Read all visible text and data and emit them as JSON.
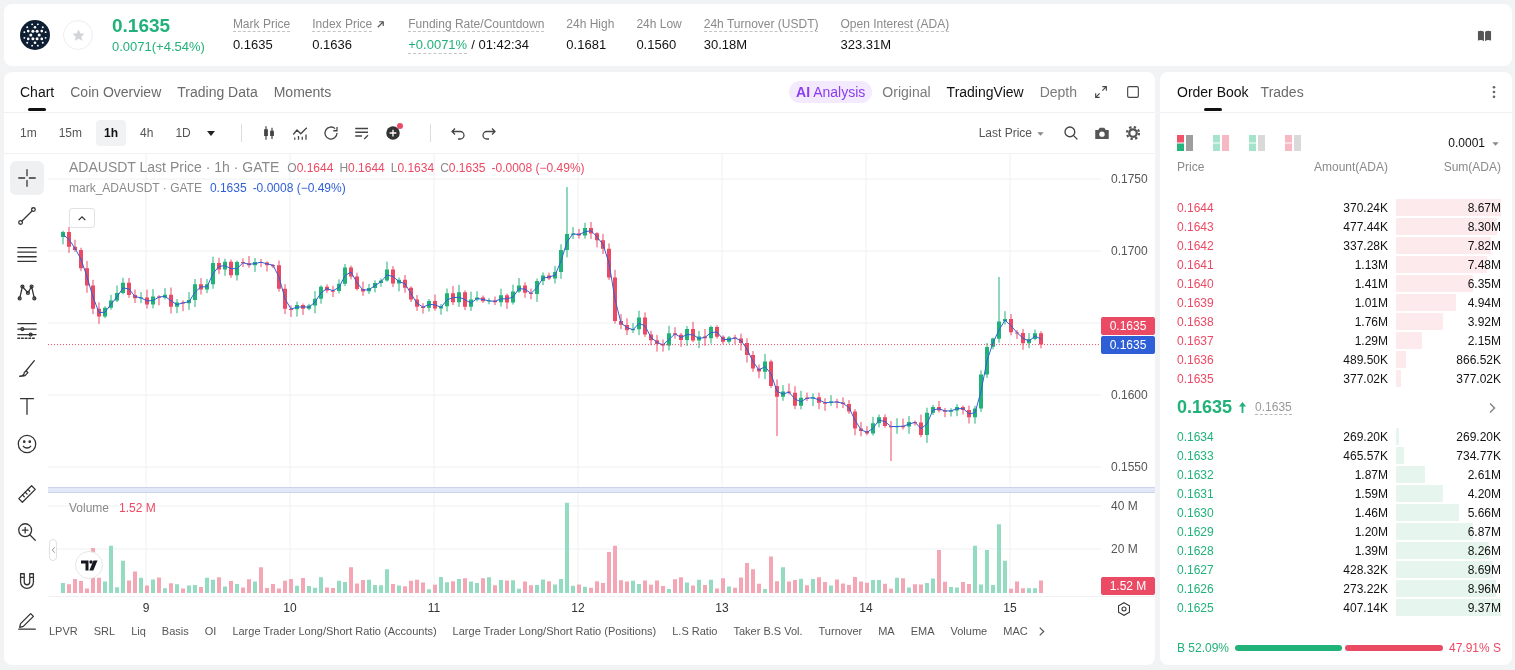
{
  "header": {
    "price": "0.1635",
    "change": "0.0071(+4.54%)",
    "rising": true,
    "favorite": false,
    "stats": [
      {
        "kind": "plain",
        "label": "Mark Price",
        "value": "0.1635",
        "underlined": true
      },
      {
        "kind": "link",
        "label": "Index Price",
        "value": "0.1636",
        "underlined": true
      },
      {
        "kind": "funding",
        "label": "Funding Rate/Countdown",
        "value": "+0.0071%",
        "rising": true,
        "countdown": "/ 01:42:34",
        "underlined": true
      },
      {
        "kind": "plain",
        "label": "24h High",
        "value": "0.1681",
        "underlined": false
      },
      {
        "kind": "plain",
        "label": "24h Low",
        "value": "0.1560",
        "underlined": false
      },
      {
        "kind": "plain",
        "label": "24h Turnover (USDT)",
        "value": "30.18M",
        "underlined": true
      },
      {
        "kind": "plain",
        "label": "Open Interest (ADA)",
        "value": "323.31M",
        "underlined": true
      }
    ]
  },
  "chart_tabs": [
    {
      "label": "Chart",
      "selected": true
    },
    {
      "label": "Coin Overview",
      "selected": false
    },
    {
      "label": "Trading Data",
      "selected": false
    },
    {
      "label": "Moments",
      "selected": false
    }
  ],
  "view_modes": [
    {
      "kind": "ai",
      "label": "**AI** Analysis",
      "selected": false
    },
    {
      "kind": "text",
      "label": "Original",
      "selected": false
    },
    {
      "kind": "text",
      "label": "TradingView",
      "selected": true
    },
    {
      "kind": "text",
      "label": "Depth",
      "selected": false
    }
  ],
  "toolbar": {
    "timeframes": [
      {
        "label": "1m",
        "selected": false
      },
      {
        "label": "15m",
        "selected": false
      },
      {
        "label": "1h",
        "selected": true
      },
      {
        "label": "4h",
        "selected": false
      },
      {
        "label": "1D",
        "selected": false
      }
    ],
    "indicator_badge": true,
    "price_source": "Last Price"
  },
  "drawing_tools": [
    [
      {
        "kind": "crosshair",
        "selected": true
      },
      {
        "kind": "trend-line",
        "selected": false
      },
      {
        "kind": "horizontal-lines",
        "selected": false
      },
      {
        "kind": "pattern",
        "selected": false
      },
      {
        "kind": "fib",
        "selected": false
      },
      {
        "kind": "brush",
        "selected": false
      },
      {
        "kind": "text",
        "selected": false
      },
      {
        "kind": "emoji",
        "selected": false
      }
    ],
    [
      {
        "kind": "ruler",
        "selected": false
      },
      {
        "kind": "zoom-in",
        "selected": false
      }
    ],
    [
      {
        "kind": "magnet",
        "selected": false
      },
      {
        "kind": "pencil",
        "selected": false
      }
    ]
  ],
  "chart": {
    "legend": {
      "title": "ADAUSDT Last Price · 1h · GATE",
      "ohlc": [
        {
          "label": "O",
          "value": "0.1644"
        },
        {
          "label": "H",
          "value": "0.1644"
        },
        {
          "label": "L",
          "value": "0.1634"
        },
        {
          "label": "C",
          "value": "0.1635"
        }
      ],
      "change": "-0.0008 (−0.49%)",
      "rising": false
    },
    "mark_legend": {
      "title": "mark_ADAUSDT · GATE",
      "values": [
        "0.1635",
        "-0.0008 (−0.49%)"
      ]
    },
    "price_axis": [
      "0.1750",
      "0.1700",
      "0.1600",
      "0.1550"
    ],
    "price_labels": [
      {
        "kind": "last",
        "value": "0.1635"
      },
      {
        "kind": "mark",
        "value": "0.1635"
      }
    ],
    "volume": {
      "title": "Volume",
      "value": "1.52 M",
      "axis": [
        "40 M",
        "20 M"
      ],
      "label": "1.52 M"
    },
    "time_axis": [
      "9",
      "10",
      "11",
      "12",
      "13",
      "14",
      "15"
    ]
  },
  "indicators": [
    "LPVR",
    "SRL",
    "Liq",
    "Basis",
    "OI",
    "Large Trader Long/Short Ratio (Accounts)",
    "Large Trader Long/Short Ratio (Positions)",
    "L.S Ratio",
    "Taker B.S Vol.",
    "Turnover",
    "MA",
    "EMA",
    "Volume",
    "MAC"
  ],
  "order_book": {
    "tabs": [
      {
        "label": "Order Book",
        "selected": true
      },
      {
        "label": "Trades",
        "selected": false
      }
    ],
    "layouts": [
      {
        "kind": "both",
        "selected": true
      },
      {
        "kind": "split",
        "selected": false
      },
      {
        "kind": "bids",
        "selected": false
      },
      {
        "kind": "asks",
        "selected": false
      }
    ],
    "precision": "0.0001",
    "columns": [
      "Price",
      "Amount(ADA)",
      "Sum(ADA)"
    ],
    "asks": [
      {
        "price": "0.1644",
        "amount": "370.24K",
        "sum": "8.67M"
      },
      {
        "price": "0.1643",
        "amount": "477.44K",
        "sum": "8.30M"
      },
      {
        "price": "0.1642",
        "amount": "337.28K",
        "sum": "7.82M"
      },
      {
        "price": "0.1641",
        "amount": "1.13M",
        "sum": "7.48M"
      },
      {
        "price": "0.1640",
        "amount": "1.41M",
        "sum": "6.35M"
      },
      {
        "price": "0.1639",
        "amount": "1.01M",
        "sum": "4.94M"
      },
      {
        "price": "0.1638",
        "amount": "1.76M",
        "sum": "3.92M"
      },
      {
        "price": "0.1637",
        "amount": "1.29M",
        "sum": "2.15M"
      },
      {
        "price": "0.1636",
        "amount": "489.50K",
        "sum": "866.52K"
      },
      {
        "price": "0.1635",
        "amount": "377.02K",
        "sum": "377.02K"
      }
    ],
    "mid": {
      "price": "0.1635",
      "rising": true,
      "mark": "0.1635"
    },
    "bids": [
      {
        "price": "0.1634",
        "amount": "269.20K",
        "sum": "269.20K"
      },
      {
        "price": "0.1633",
        "amount": "465.57K",
        "sum": "734.77K"
      },
      {
        "price": "0.1632",
        "amount": "1.87M",
        "sum": "2.61M"
      },
      {
        "price": "0.1631",
        "amount": "1.59M",
        "sum": "4.20M"
      },
      {
        "price": "0.1630",
        "amount": "1.46M",
        "sum": "5.66M"
      },
      {
        "price": "0.1629",
        "amount": "1.20M",
        "sum": "6.87M"
      },
      {
        "price": "0.1628",
        "amount": "1.39M",
        "sum": "8.26M"
      },
      {
        "price": "0.1627",
        "amount": "428.32K",
        "sum": "8.69M"
      },
      {
        "price": "0.1626",
        "amount": "273.22K",
        "sum": "8.96M"
      },
      {
        "price": "0.1625",
        "amount": "407.14K",
        "sum": "9.37M"
      }
    ],
    "ratio": {
      "buy": "B 52.09%",
      "sell": "47.91% S"
    }
  }
}
